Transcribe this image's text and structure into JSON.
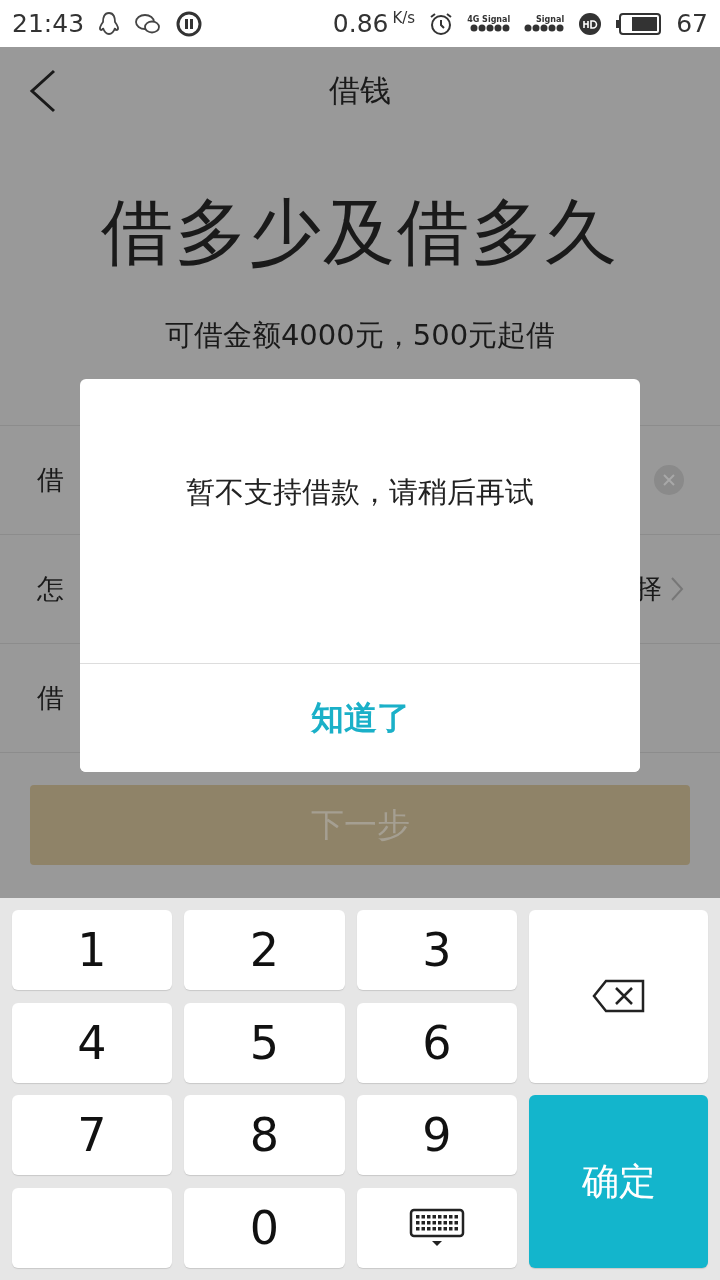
{
  "status_bar": {
    "time": "21:43",
    "speed": "0.86",
    "speed_unit": "K/s",
    "network": "4G",
    "signal_labels": [
      "Signal",
      "Signal"
    ],
    "battery": "67"
  },
  "header": {
    "title": "借钱"
  },
  "hero": {
    "heading": "借多少及借多久",
    "subtitle": "可借金额4000元，500元起借"
  },
  "rows": [
    {
      "kind": "input",
      "label": "借"
    },
    {
      "kind": "select",
      "label": "怎",
      "value": "择"
    },
    {
      "kind": "plain",
      "label": "借"
    }
  ],
  "next_button": {
    "label": "下一步",
    "disabled": true
  },
  "dialog": {
    "message": "暂不支持借款，请稍后再试",
    "button": "知道了"
  },
  "keypad": [
    {
      "kind": "digit",
      "label": "1"
    },
    {
      "kind": "digit",
      "label": "2"
    },
    {
      "kind": "digit",
      "label": "3"
    },
    {
      "kind": "backspace"
    },
    {
      "kind": "digit",
      "label": "4"
    },
    {
      "kind": "digit",
      "label": "5"
    },
    {
      "kind": "digit",
      "label": "6"
    },
    {
      "kind": "digit",
      "label": "7"
    },
    {
      "kind": "digit",
      "label": "8"
    },
    {
      "kind": "digit",
      "label": "9"
    },
    {
      "kind": "confirm",
      "label": "确定"
    },
    {
      "kind": "blank"
    },
    {
      "kind": "digit",
      "label": "0"
    },
    {
      "kind": "hide"
    }
  ]
}
